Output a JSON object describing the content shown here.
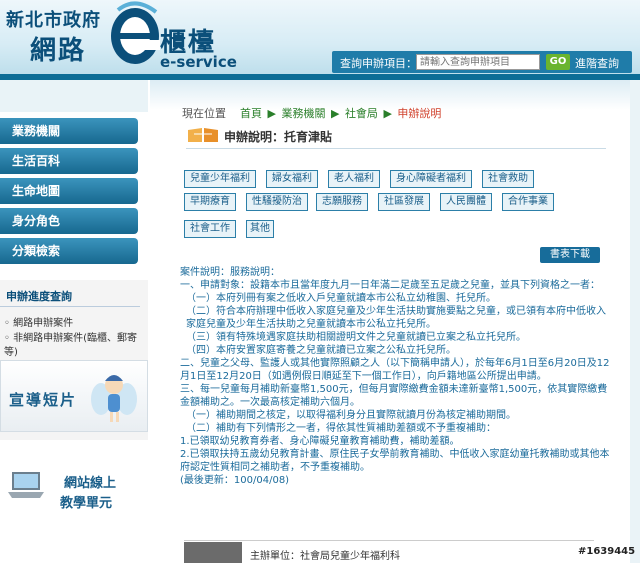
{
  "header": {
    "city": "新北市政府",
    "main_left": "網路",
    "main_right": "櫃檯",
    "eservice": "e-service",
    "search_label": "查詢申辦項目：",
    "search_placeholder": "請輸入查詢申辦項目",
    "go_label": "GO",
    "advanced_label": "進階查詢"
  },
  "sidebar": {
    "items": [
      "業務機關",
      "生活百科",
      "生命地圖",
      "身分角色",
      "分類檢索"
    ],
    "apply_title": "申辦進度查詢",
    "apply_link1": "網路申辦案件",
    "apply_link2": "非網路申辦案件(臨櫃、郵寄等)",
    "promo_label": "宣導短片",
    "online_line1": "網站線上",
    "online_line2": "教學單元"
  },
  "breadcrumb": {
    "prefix": "現在位置",
    "items": [
      "首頁",
      "業務機關",
      "社會局"
    ],
    "current": "申辦說明"
  },
  "page_title": "申辦說明：托育津貼",
  "categories": [
    "兒童少年福利",
    "婦女福利",
    "老人福利",
    "身心障礙者福利",
    "社會救助",
    "早期療育",
    "性騷擾防治",
    "志願服務",
    "社區發展",
    "人民團體",
    "合作事業",
    "社會工作",
    "其他"
  ],
  "download_label": "書表下載",
  "article": {
    "line0": "案件說明：服務說明：",
    "p1": "一、申請對象：設籍本市且當年度九月一日年滿二足歲至五足歲之兒童，並具下列資格之一者：",
    "p1a": "（一）本府列冊有案之低收入戶兒童就讀本市公私立幼稚園、托兒所。",
    "p1b": "（二）符合本府辦理中低收入家庭兒童及少年生活扶助實施要點之兒童，或已領有本府中低收入家庭兒童及少年生活扶助之兒童就讀本市公私立托兒所。",
    "p1c": "（三）領有特殊境遇家庭扶助相關證明文件之兒童就讀已立案之私立托兒所。",
    "p1d": "（四）本府安置家庭寄養之兒童就讀已立案之公私立托兒所。",
    "p2": "二、兒童之父母、監護人或其他實際照顧之人（以下簡稱申請人），於每年6月1日至6月20日及12月1日至12月20日（如遇例假日順延至下一個工作日），向戶籍地區公所提出申請。",
    "p3": "三、每一兒童每月補助新臺幣1,500元，但每月實際繳費金額未達新臺幣1,500元，依其實際繳費金額補助之。一次最高核定補助六個月。",
    "p3a": "（一）補助期間之核定，以取得福利身分且實際就讀月份為核定補助期間。",
    "p3b": "（二）補助有下列情形之一者，得依其性質補助差額或不予重複補助：",
    "p4": "1.已領取幼兒教育券者、身心障礙兒童教育補助費，補助差額。",
    "p5": "2.已領取扶持五歲幼兒教育計畫、原住民子女學前教育補助、中低收入家庭幼童托教補助或其他本府認定性質相同之補助者，不予重複補助。",
    "last_update": "(最後更新：100/04/08)"
  },
  "footer": {
    "text": "主辦單位：社會局兒童少年福利科"
  },
  "watermark": "#1639445",
  "colors": {
    "brand_blue": "#0b4f7a",
    "menu_blue": "#17688f",
    "breadcrumb_green": "#2a7f2a",
    "breadcrumb_current": "#d0402b",
    "article_blue": "#1b6b9b"
  }
}
